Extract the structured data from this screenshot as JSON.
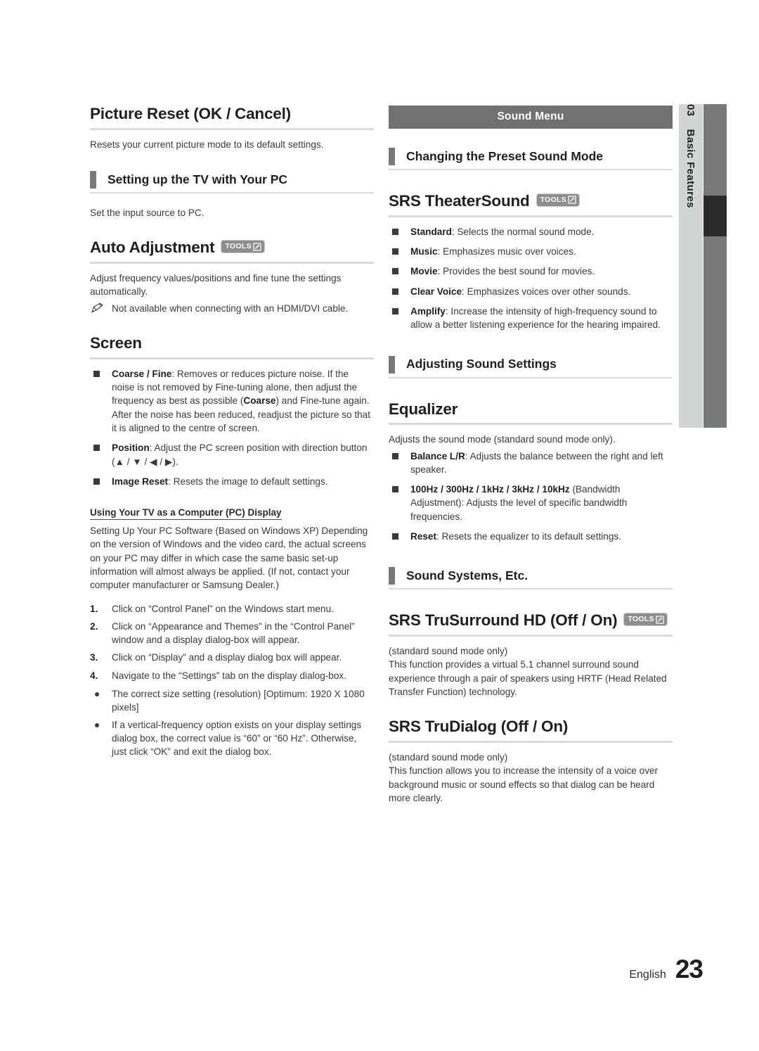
{
  "side_tab": {
    "number": "03",
    "label": "Basic Features"
  },
  "footer": {
    "language": "English",
    "page_number": "23"
  },
  "badges": {
    "tools_label": "TOOLS"
  },
  "left_column": {
    "picture_reset": {
      "heading": "Picture Reset (OK / Cancel)",
      "body": "Resets your current picture mode to its default settings."
    },
    "setting_up_pc": {
      "section_title": "Setting up the TV with Your PC",
      "body": "Set the input source to PC."
    },
    "auto_adjustment": {
      "heading": "Auto Adjustment",
      "body": "Adjust frequency values/positions and fine tune the settings automatically.",
      "note": "Not available when connecting with an HDMI/DVI cable."
    },
    "screen": {
      "heading": "Screen",
      "items": [
        {
          "term": "Coarse / Fine",
          "rest": ": Removes or reduces picture noise. If the noise is not removed by Fine-tuning alone, then adjust the frequency as best as possible (",
          "term2": "Coarse",
          "rest2": ") and Fine-tune again. After the noise has been reduced, readjust the picture so that it is aligned to the centre of screen."
        },
        {
          "term": "Position",
          "rest": ": Adjust the PC screen position with direction button (▲ / ▼ / ◀ / ▶)."
        },
        {
          "term": "Image Reset",
          "rest": ": Resets the image to default settings."
        }
      ]
    },
    "pc_display": {
      "subheading": "Using Your TV as a Computer (PC) Display",
      "intro": "Setting Up Your PC Software (Based on Windows XP) Depending on the version of Windows and the video card, the actual screens on your PC may differ in which case the same basic set-up information will almost always be applied. (If not, contact your computer manufacturer or Samsung Dealer.)",
      "steps": [
        "Click on “Control Panel” on the Windows start menu.",
        "Click on “Appearance and Themes” in the “Control Panel” window and a display dialog-box will appear.",
        "Click on “Display” and a display dialog box will appear.",
        "Navigate to the “Settings” tab on the display dialog-box."
      ],
      "bullets": [
        "The correct size setting (resolution) [Optimum: 1920 X 1080 pixels]",
        "If a vertical-frequency option exists on your display settings dialog box, the correct value is “60” or “60 Hz”. Otherwise, just click “OK” and exit the dialog box."
      ]
    }
  },
  "right_column": {
    "menu_bar": "Sound Menu",
    "preset_sound_mode": {
      "section_title": "Changing the Preset Sound Mode"
    },
    "srs_theatersound": {
      "heading": "SRS TheaterSound",
      "items": [
        {
          "term": "Standard",
          "rest": ": Selects the normal sound mode."
        },
        {
          "term": "Music",
          "rest": ": Emphasizes music over voices."
        },
        {
          "term": "Movie",
          "rest": ": Provides the best sound for movies."
        },
        {
          "term": "Clear Voice",
          "rest": ": Emphasizes voices over other sounds."
        },
        {
          "term": "Amplify",
          "rest": ": Increase the intensity of high-frequency sound to allow a better listening experience for the hearing impaired."
        }
      ]
    },
    "adjusting_sound_settings": {
      "section_title": "Adjusting Sound Settings"
    },
    "equalizer": {
      "heading": "Equalizer",
      "body": "Adjusts the sound mode (standard sound mode only).",
      "items": [
        {
          "term": "Balance L/R",
          "rest": ": Adjusts the balance between the right and left speaker."
        },
        {
          "term": "100Hz / 300Hz / 1kHz / 3kHz / 10kHz",
          "rest": " (Bandwidth Adjustment): Adjusts the level of specific bandwidth frequencies."
        },
        {
          "term": "Reset",
          "rest": ": Resets the equalizer to its default settings."
        }
      ]
    },
    "sound_systems": {
      "section_title": "Sound Systems, Etc."
    },
    "srs_trusurround": {
      "heading": "SRS TruSurround HD (Off / On)",
      "note": "(standard sound mode only)",
      "body": "This function provides a virtual 5.1 channel surround sound experience through a pair of speakers using HRTF (Head Related Transfer Function) technology."
    },
    "srs_trudialog": {
      "heading": "SRS TruDialog (Off / On)",
      "note": "(standard sound mode only)",
      "body": "This function allows you to increase the intensity of a voice over background music or sound effects so that dialog can be heard more clearly."
    }
  }
}
